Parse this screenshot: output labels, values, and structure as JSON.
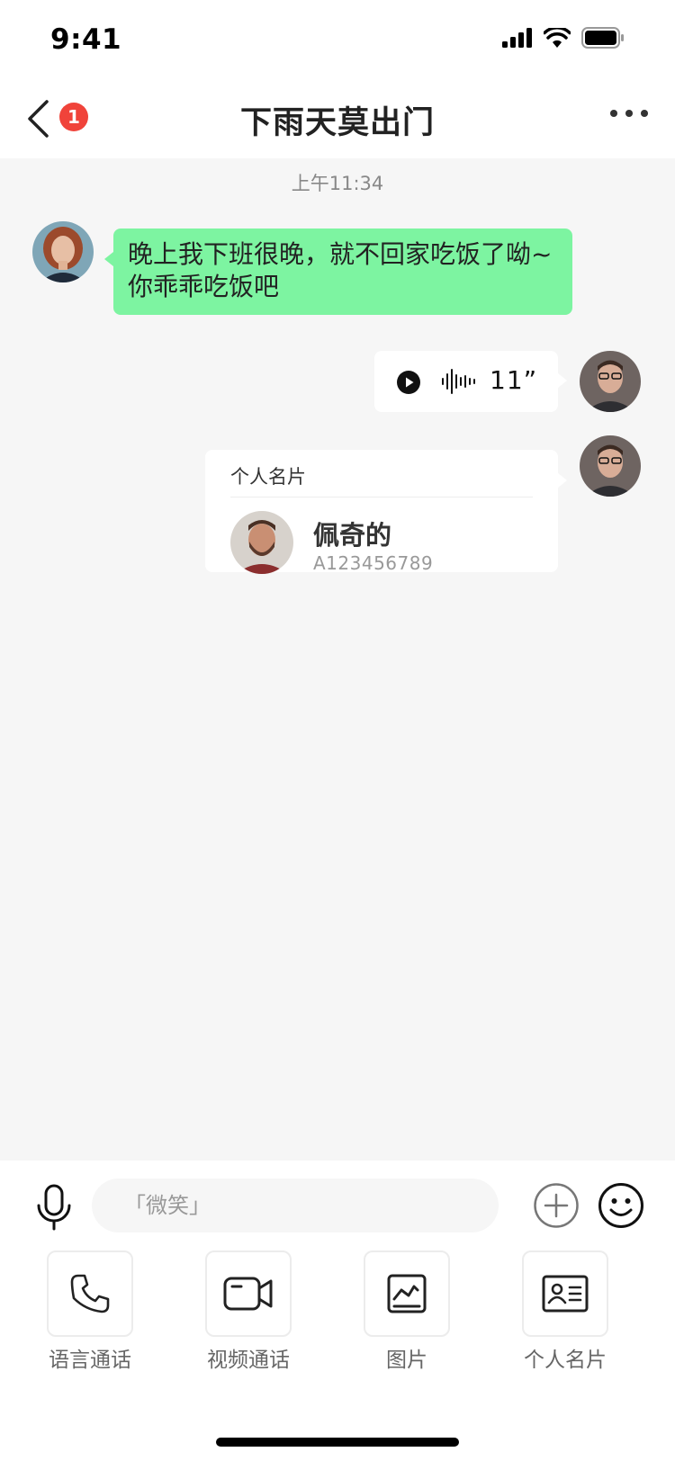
{
  "status_bar": {
    "time": "9:41"
  },
  "nav": {
    "unread_count": "1",
    "title": "下雨天莫出门"
  },
  "chat": {
    "timestamp": "上午11:34",
    "messages": [
      {
        "type": "text",
        "direction": "incoming",
        "text": "晚上我下班很晚，就不回家吃饭了呦~你乖乖吃饭吧"
      },
      {
        "type": "voice",
        "direction": "outgoing",
        "duration": "11”"
      },
      {
        "type": "card",
        "direction": "outgoing",
        "header": "个人名片",
        "name": "佩奇的",
        "id": "A123456789"
      }
    ]
  },
  "input_bar": {
    "placeholder": "「微笑」"
  },
  "actions": [
    {
      "label": "语言通话",
      "icon": "phone-icon"
    },
    {
      "label": "视频通话",
      "icon": "video-camera-icon"
    },
    {
      "label": "图片",
      "icon": "image-icon"
    },
    {
      "label": "个人名片",
      "icon": "contact-card-icon"
    }
  ],
  "colors": {
    "incoming_bubble": "#7df4a1",
    "badge": "#f0433a",
    "chat_background": "#f6f6f6"
  }
}
